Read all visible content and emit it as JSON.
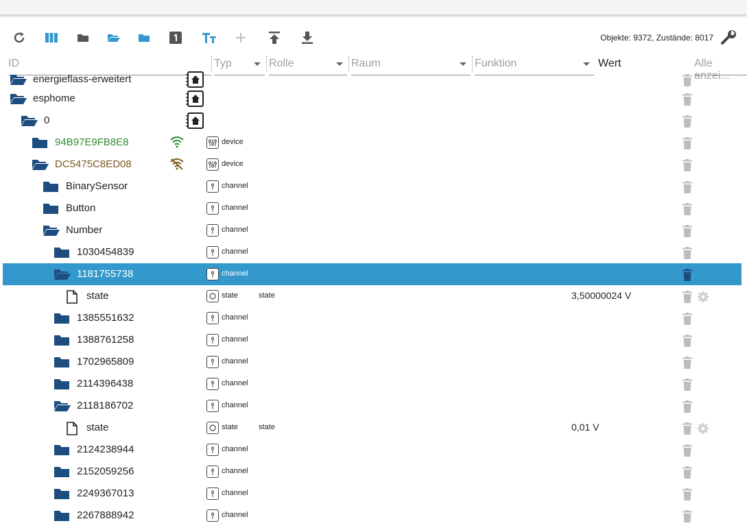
{
  "toolbar": {
    "counts": "Objekte: 9372, Zustände: 8017",
    "icons": [
      "refresh-icon",
      "columns-icon",
      "folder-closed-icon",
      "folder-open-icon",
      "folder-icon",
      "number-one-icon",
      "text-size-icon",
      "plus-icon",
      "upload-icon",
      "download-icon",
      "wrench-icon"
    ]
  },
  "filters": {
    "id": "ID",
    "typ": "Typ",
    "rolle": "Rolle",
    "raum": "Raum",
    "funktion": "Funktion",
    "wert": "Wert",
    "alle": "Alle anzei..."
  },
  "colors": {
    "selected": "#3399cc",
    "folder": "#1e4d80",
    "online": "#2e8b2e",
    "offline": "#7a5a1f",
    "trash": "#bdbdbd"
  },
  "rows": [
    {
      "name": "energieflass-erweitert",
      "type": "",
      "role": "",
      "value": ""
    },
    {
      "name": "esphome",
      "type": "",
      "role": "",
      "value": ""
    },
    {
      "name": "0",
      "type": "",
      "role": "",
      "value": ""
    },
    {
      "name": "94B97E9FB8E8",
      "type": "device",
      "role": "",
      "value": "",
      "status": "online"
    },
    {
      "name": "DC5475C8ED08",
      "type": "device",
      "role": "",
      "value": "",
      "status": "offline"
    },
    {
      "name": "BinarySensor",
      "type": "channel",
      "role": "",
      "value": ""
    },
    {
      "name": "Button",
      "type": "channel",
      "role": "",
      "value": ""
    },
    {
      "name": "Number",
      "type": "channel",
      "role": "",
      "value": ""
    },
    {
      "name": "1030454839",
      "type": "channel",
      "role": "",
      "value": ""
    },
    {
      "name": "1181755738",
      "type": "channel",
      "role": "",
      "value": "",
      "selected": true
    },
    {
      "name": "state",
      "type": "state",
      "role": "state",
      "value": "3,50000024 V"
    },
    {
      "name": "1385551632",
      "type": "channel",
      "role": "",
      "value": ""
    },
    {
      "name": "1388761258",
      "type": "channel",
      "role": "",
      "value": ""
    },
    {
      "name": "1702965809",
      "type": "channel",
      "role": "",
      "value": ""
    },
    {
      "name": "2114396438",
      "type": "channel",
      "role": "",
      "value": ""
    },
    {
      "name": "2118186702",
      "type": "channel",
      "role": "",
      "value": ""
    },
    {
      "name": "state",
      "type": "state",
      "role": "state",
      "value": "0,01 V"
    },
    {
      "name": "2124238944",
      "type": "channel",
      "role": "",
      "value": ""
    },
    {
      "name": "2152059256",
      "type": "channel",
      "role": "",
      "value": ""
    },
    {
      "name": "2249367013",
      "type": "channel",
      "role": "",
      "value": ""
    },
    {
      "name": "2267888942",
      "type": "channel",
      "role": "",
      "value": ""
    }
  ]
}
